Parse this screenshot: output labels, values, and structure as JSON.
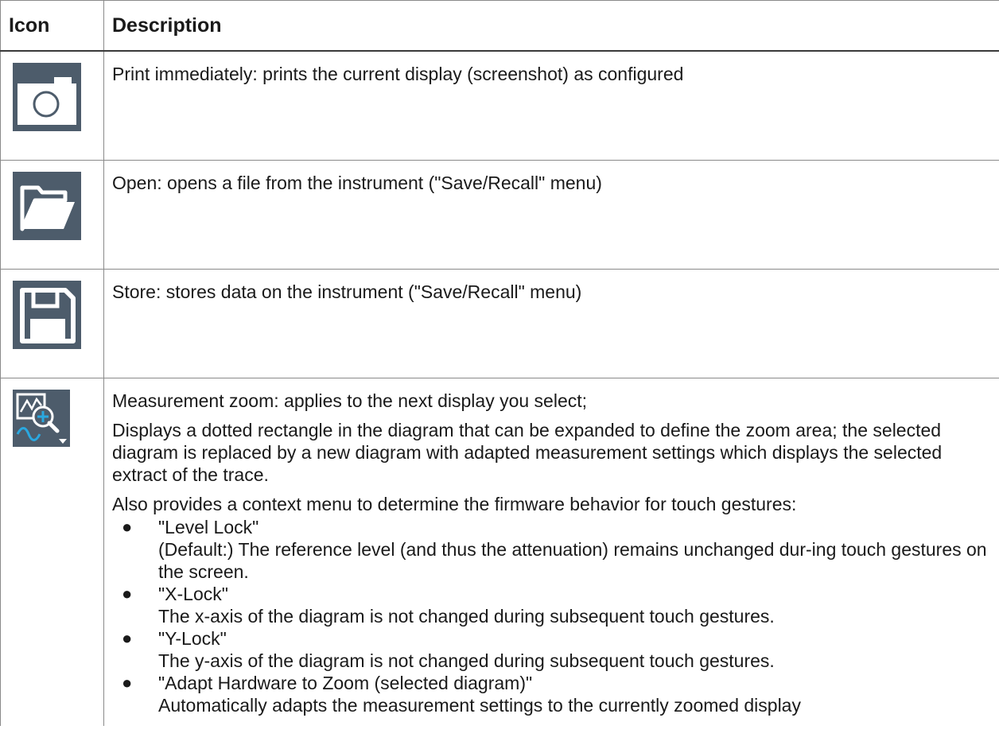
{
  "table": {
    "headers": {
      "icon": "Icon",
      "description": "Description"
    },
    "rows": [
      {
        "icon": "camera-icon",
        "paragraphs": [
          "Print immediately: prints the current display (screenshot) as configured"
        ]
      },
      {
        "icon": "open-folder-icon",
        "paragraphs": [
          "Open: opens a file from the instrument (\"Save/Recall\" menu)"
        ]
      },
      {
        "icon": "floppy-disk-icon",
        "paragraphs": [
          "Store: stores data on the instrument (\"Save/Recall\" menu)"
        ]
      },
      {
        "icon": "measurement-zoom-icon",
        "paragraphs": [
          "Measurement zoom: applies to the next display you select;",
          "Displays a dotted rectangle in the diagram that can be expanded to define the zoom area; the selected diagram is replaced by a new diagram with adapted measurement settings which displays the selected extract of the trace.",
          "Also provides a context menu to determine the firmware behavior for touch gestures:"
        ],
        "options": [
          {
            "name": "\"Level Lock\"",
            "text": "(Default:) The reference level (and thus the attenuation) remains unchanged dur-ing touch gestures on the screen."
          },
          {
            "name": "\"X-Lock\"",
            "text": "The x-axis of the diagram is not changed during subsequent touch gestures."
          },
          {
            "name": "\"Y-Lock\"",
            "text": "The y-axis of the diagram is not changed during subsequent touch gestures."
          },
          {
            "name": "\"Adapt Hardware to Zoom (selected diagram)\"",
            "text": "Automatically adapts the measurement settings to the currently zoomed display"
          }
        ]
      }
    ]
  },
  "colors": {
    "icon_background": "#4d5c6b",
    "icon_foreground": "#ffffff",
    "zoom_accent": "#2aa8e0"
  }
}
